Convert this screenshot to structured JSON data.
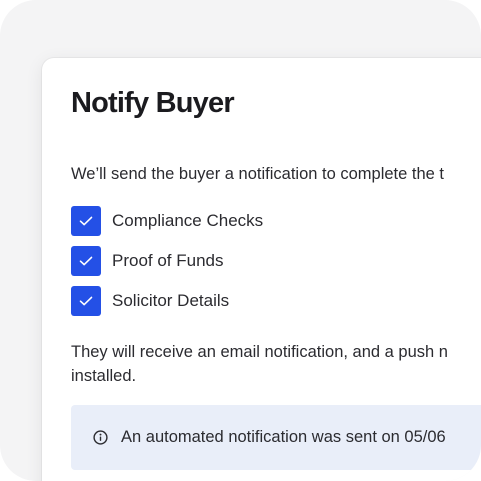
{
  "dialog": {
    "title": "Notify Buyer",
    "intro": "We’ll send the buyer a notification to complete the t",
    "checklist": [
      {
        "label": "Compliance Checks",
        "checked": true
      },
      {
        "label": "Proof of Funds",
        "checked": true
      },
      {
        "label": "Solicitor Details",
        "checked": true
      }
    ],
    "outro_line1": "They will receive an email notification, and a push n",
    "outro_line2": "installed.",
    "info_banner": {
      "icon": "info-icon",
      "text": "An automated notification was sent on 05/06"
    }
  },
  "colors": {
    "accent": "#2450e6",
    "banner_bg": "#e9eef9",
    "text": "#2b2b30",
    "backdrop": "#f4f4f5"
  }
}
